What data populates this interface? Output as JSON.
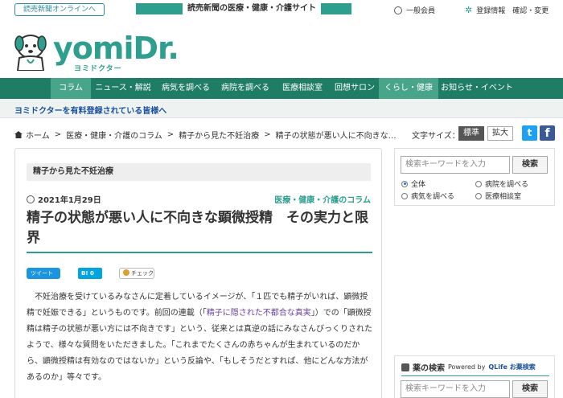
{
  "topbar": {
    "yomiuri_link": "読売新聞オンラインへ",
    "site_banner": "読売新聞の医療・健康・介護サイト",
    "member": "一般会員",
    "registration": "登録情報　確認・変更"
  },
  "logo": {
    "main": "yomiDr.",
    "sub": "ヨミドクター"
  },
  "nav": {
    "items": [
      {
        "label": "コラム"
      },
      {
        "label": "ニュース・解説"
      },
      {
        "label": "病気を調べる"
      },
      {
        "label": "病院を調べる"
      },
      {
        "label": "医療相談室"
      },
      {
        "label": "回想サロン"
      },
      {
        "label": "くらし・健康"
      },
      {
        "label": "お知らせ・イベント"
      }
    ],
    "active": [
      "コラム",
      "くらし・健康"
    ]
  },
  "notice": "ヨミドクターを有料登録されている皆様へ",
  "breadcrumb": {
    "home": "ホーム",
    "items": [
      "医療・健康・介護のコラム",
      "精子から見た不妊治療",
      "精子の状態が悪い人に不向きな…"
    ]
  },
  "font_size": {
    "label": "文字サイズ：",
    "standard": "標準",
    "large": "拡大"
  },
  "social": {
    "twitter": "t",
    "facebook": "f"
  },
  "article": {
    "series": "精子から見た不妊治療",
    "date": "2021年1月29日",
    "category": "医療・健康・介護のコラム",
    "title": "精子の状態が悪い人に不向きな顕微授精　その実力と限界",
    "share": {
      "tweet": "ツイート",
      "hatena": "B! 0",
      "mixi": "チェック"
    },
    "body_before_link": "不妊治療を受けているみなさんに定着しているイメージが、「１匹でも精子がいれば、顕微授精で妊娠できる」というものです。前回の連載（「",
    "body_link": "精子に隠された不都合な真実",
    "body_after_link": "」）での「顕微授精は精子の状態が悪い方には不向きです」という、従来とは真逆の話にみなさんびっくりされたようで、様々な質問をいただきました。「これまでたくさんの赤ちゃんが生まれているのだから、顕微授精は有効なのではないか」という反論や、「もしそうだとすれば、他にどんな方法があるのか」等々です。"
  },
  "sidebar": {
    "search": {
      "placeholder": "検索キーワードを入力",
      "button": "検索",
      "options": [
        "全体",
        "病院を調べる",
        "病気を調べる",
        "医療相談室"
      ],
      "selected": "全体"
    },
    "drug": {
      "title": "薬の検索",
      "powered": "Powered by",
      "provider": "QLife お薬検索",
      "placeholder": "検索キーワードを入力",
      "button": "検索"
    }
  },
  "colors": {
    "brand": "#2e9e8e",
    "nav": "#1f7d65",
    "nav_active": "#49a58a",
    "twitter": "#1da1f2",
    "facebook": "#3b5998"
  }
}
